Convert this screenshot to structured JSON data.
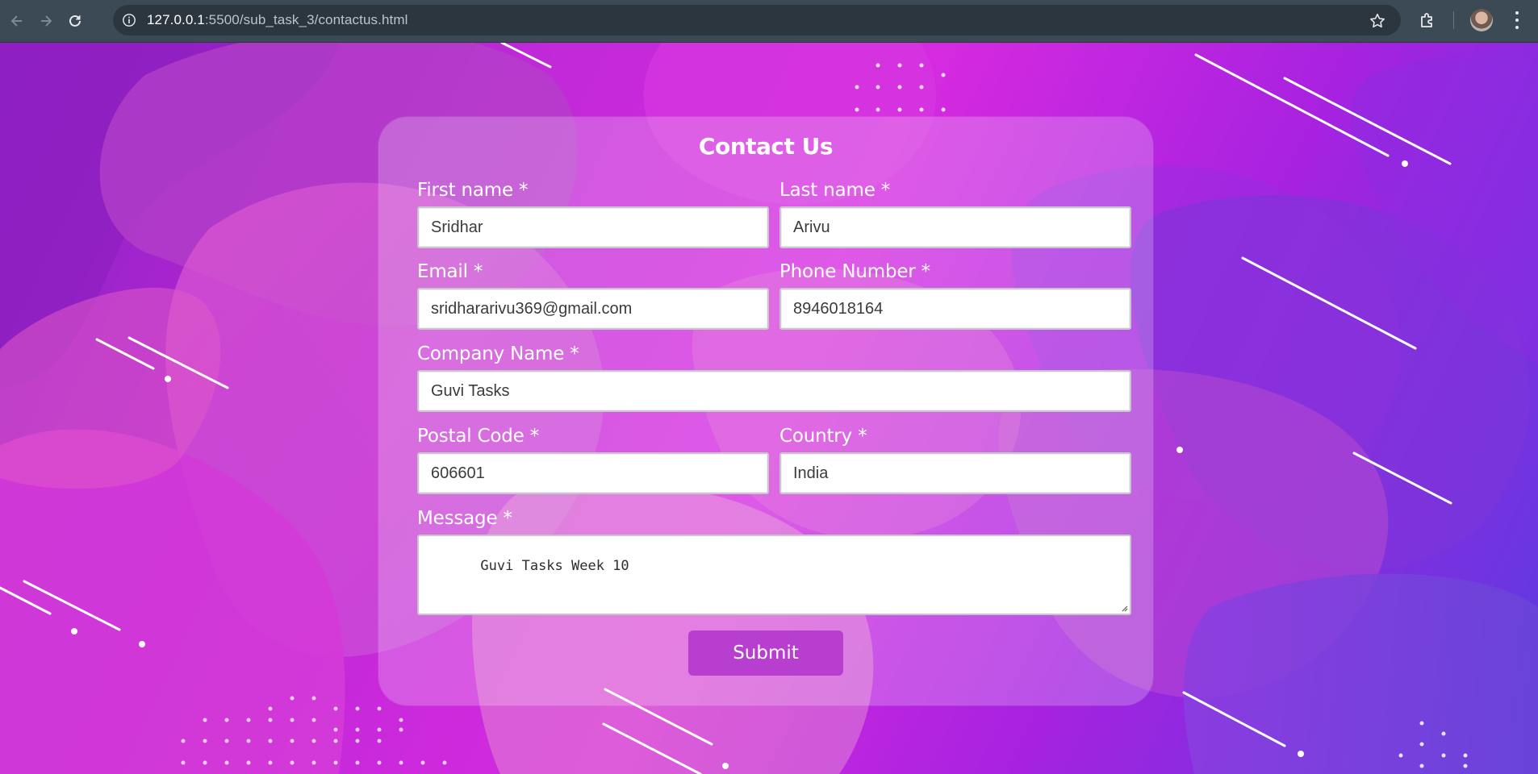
{
  "browser": {
    "url_host": "127.0.0.1",
    "url_rest": ":5500/sub_task_3/contactus.html"
  },
  "form": {
    "title": "Contact Us",
    "first_name": {
      "label": "First name *",
      "value": "Sridhar"
    },
    "last_name": {
      "label": "Last name *",
      "value": "Arivu"
    },
    "email": {
      "label": "Email *",
      "value": "sridhararivu369@gmail.com"
    },
    "phone": {
      "label": "Phone Number *",
      "value": "8946018164"
    },
    "company": {
      "label": "Company Name *",
      "value": "Guvi Tasks"
    },
    "postal": {
      "label": "Postal Code *",
      "value": "606601"
    },
    "country": {
      "label": "Country *",
      "value": "India"
    },
    "message": {
      "label": "Message *",
      "value": "Guvi Tasks Week 10"
    },
    "submit_label": "Submit"
  },
  "colors": {
    "accent": "#b83ed0",
    "chrome": "#3c4a55"
  },
  "icons": [
    "back-icon",
    "forward-icon",
    "reload-icon",
    "site-info-icon",
    "bookmark-star-icon",
    "extensions-icon",
    "profile-avatar",
    "menu-icon"
  ]
}
